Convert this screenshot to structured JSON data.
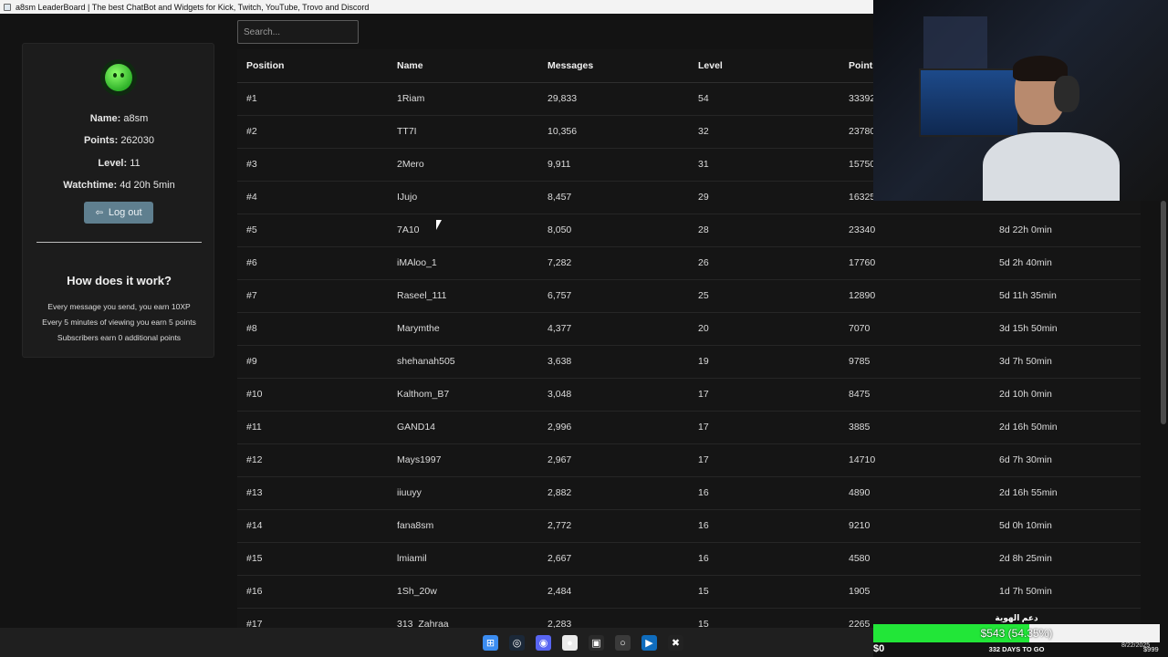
{
  "window": {
    "title": "a8sm LeaderBoard | The best ChatBot and Widgets for Kick, Twitch, YouTube, Trovo and Discord"
  },
  "profile": {
    "name_label": "Name:",
    "name_value": "a8sm",
    "points_label": "Points:",
    "points_value": "262030",
    "level_label": "Level:",
    "level_value": "11",
    "watchtime_label": "Watchtime:",
    "watchtime_value": "4d 20h 5min",
    "logout_label": "Log out"
  },
  "how_it_works": {
    "title": "How does it work?",
    "lines": [
      "Every message you send, you earn 10XP",
      "Every 5 minutes of viewing you earn 5 points",
      "Subscribers earn 0 additional points"
    ]
  },
  "search": {
    "placeholder": "Search..."
  },
  "table": {
    "headers": [
      "Position",
      "Name",
      "Messages",
      "Level",
      "Points",
      ""
    ],
    "rows": [
      [
        "#1",
        "1Riam",
        "29,833",
        "54",
        "33392",
        ""
      ],
      [
        "#2",
        "TT7I",
        "10,356",
        "32",
        "23780",
        ""
      ],
      [
        "#3",
        "2Mero",
        "9,911",
        "31",
        "15750",
        ""
      ],
      [
        "#4",
        "IJujo",
        "8,457",
        "29",
        "16325",
        ""
      ],
      [
        "#5",
        "7A10",
        "8,050",
        "28",
        "23340",
        "8d 22h 0min"
      ],
      [
        "#6",
        "iMAloo_1",
        "7,282",
        "26",
        "17760",
        "5d 2h 40min"
      ],
      [
        "#7",
        "Raseel_111",
        "6,757",
        "25",
        "12890",
        "5d 11h 35min"
      ],
      [
        "#8",
        "Marymthe",
        "4,377",
        "20",
        "7070",
        "3d 15h 50min"
      ],
      [
        "#9",
        "shehanah505",
        "3,638",
        "19",
        "9785",
        "3d 7h 50min"
      ],
      [
        "#10",
        "Kalthom_B7",
        "3,048",
        "17",
        "8475",
        "2d 10h 0min"
      ],
      [
        "#11",
        "GAND14",
        "2,996",
        "17",
        "3885",
        "2d 16h 50min"
      ],
      [
        "#12",
        "Mays1997",
        "2,967",
        "17",
        "14710",
        "6d 7h 30min"
      ],
      [
        "#13",
        "iiuuyy",
        "2,882",
        "16",
        "4890",
        "2d 16h 55min"
      ],
      [
        "#14",
        "fana8sm",
        "2,772",
        "16",
        "9210",
        "5d 0h 10min"
      ],
      [
        "#15",
        "lmiamil",
        "2,667",
        "16",
        "4580",
        "2d 8h 25min"
      ],
      [
        "#16",
        "1Sh_20w",
        "2,484",
        "15",
        "1905",
        "1d 7h 50min"
      ],
      [
        "#17",
        "313_Zahraa",
        "2,283",
        "15",
        "2265",
        ""
      ]
    ]
  },
  "goal": {
    "title": "دعم الهوية",
    "amount": "$543 (54.35%)",
    "progress": 0.5435,
    "min": "$0",
    "days": "332 DAYS TO GO",
    "date": "8/22/2025",
    "max": "$999"
  },
  "colors": {
    "background": "#131313",
    "button": "#5f7f8f",
    "goal_fill": "#22e638"
  },
  "taskbar": {
    "icons": [
      "windows-start-icon",
      "steam-icon",
      "discord-icon",
      "chrome-icon",
      "store-icon",
      "obs-icon",
      "edge-icon",
      "capcut-icon"
    ]
  }
}
